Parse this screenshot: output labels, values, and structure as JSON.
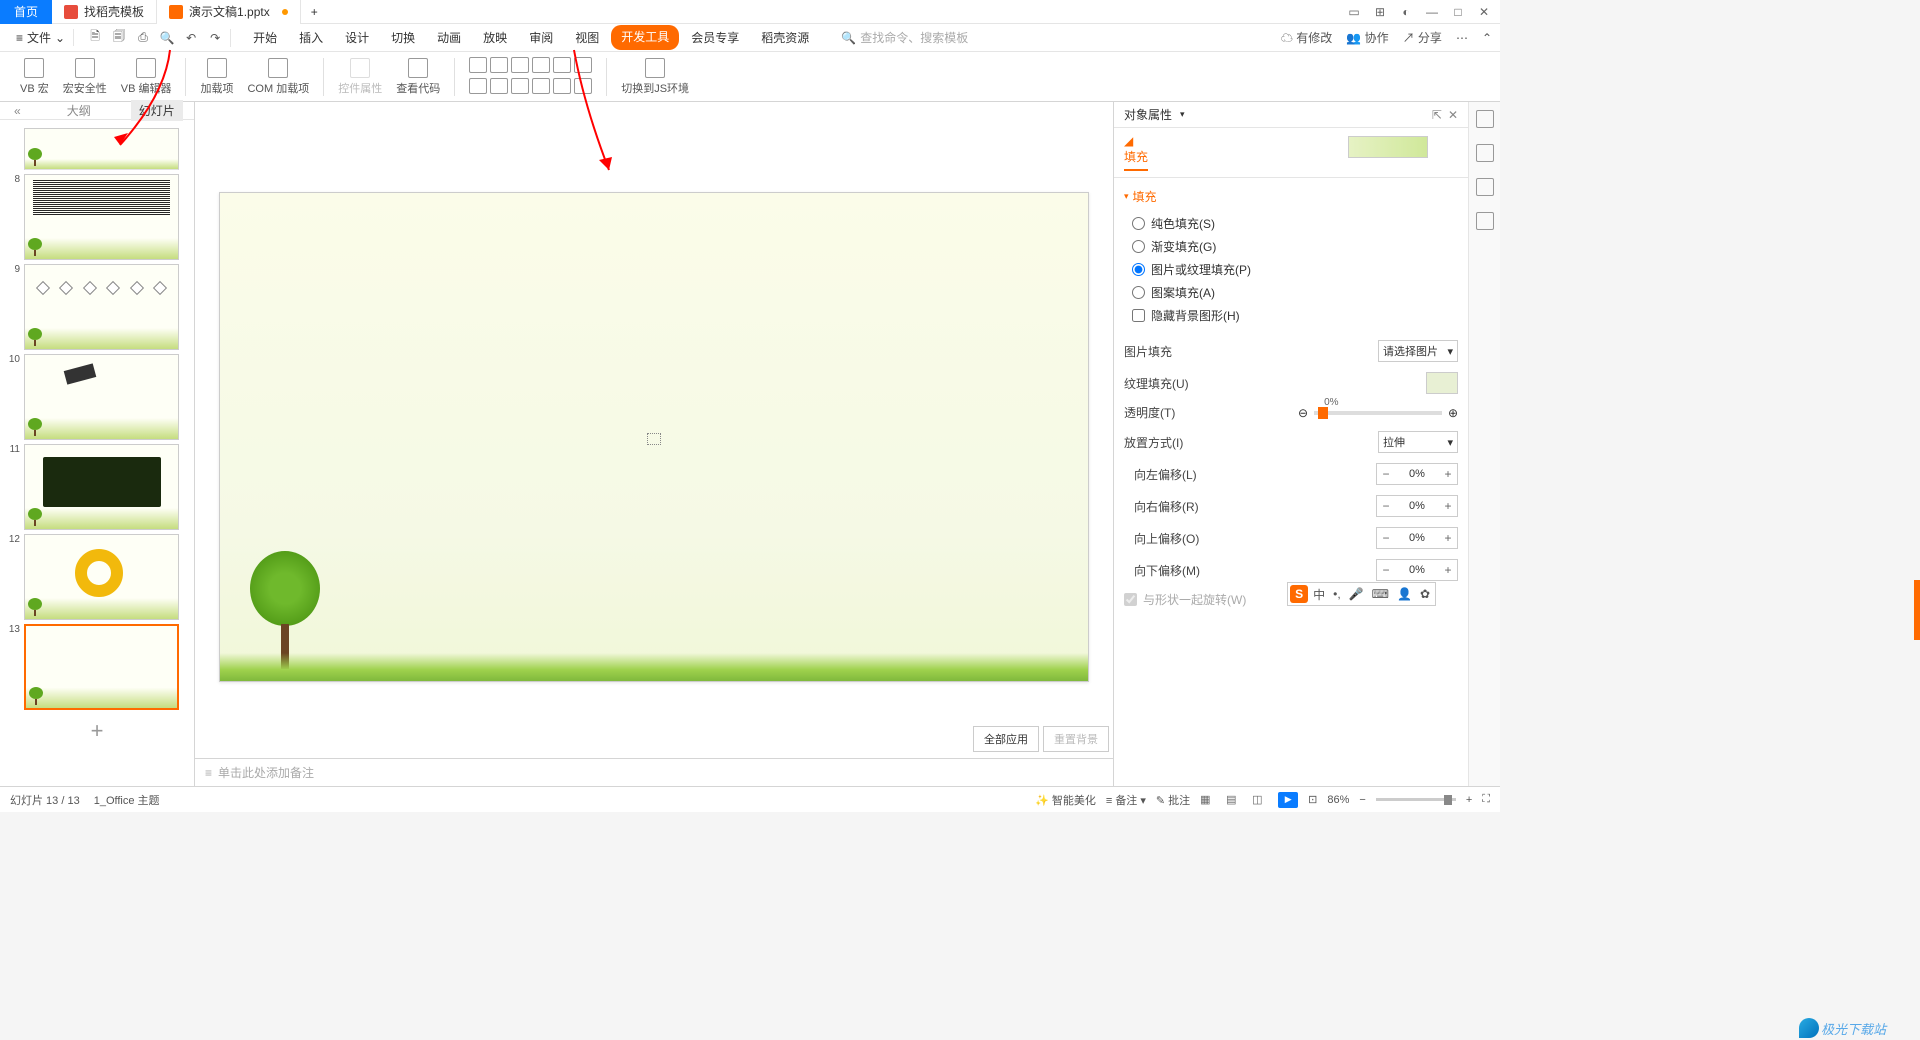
{
  "tabs": {
    "home": "首页",
    "doc1": "找稻壳模板",
    "doc2": "演示文稿1.pptx",
    "add": "+"
  },
  "file_menu": "文件",
  "menu": {
    "start": "开始",
    "insert": "插入",
    "design": "设计",
    "transition": "切换",
    "animation": "动画",
    "slideshow": "放映",
    "review": "审阅",
    "view": "视图",
    "developer": "开发工具",
    "member": "会员专享",
    "resource": "稻壳资源"
  },
  "search_placeholder": "查找命令、搜索模板",
  "top_right": {
    "pending": "有修改",
    "coop": "协作",
    "share": "分享"
  },
  "ribbon": {
    "vb_macro": "VB 宏",
    "macro_security": "宏安全性",
    "vb_editor": "VB 编辑器",
    "addins": "加载项",
    "com_addins": "COM 加载项",
    "ctl_props": "控件属性",
    "view_code": "查看代码",
    "switch_js": "切换到JS环境"
  },
  "outline": {
    "collapse": "«",
    "tab_outline": "大纲",
    "tab_slides": "幻灯片",
    "add": "+"
  },
  "thumbs": [
    {
      "num": "8"
    },
    {
      "num": "9"
    },
    {
      "num": "10"
    },
    {
      "num": "11"
    },
    {
      "num": "12"
    },
    {
      "num": "13"
    }
  ],
  "notes_placeholder": "单击此处添加备注",
  "panel_actions": {
    "apply_all": "全部应用",
    "reset_bg": "重置背景"
  },
  "rp": {
    "title": "对象属性",
    "subtab": "填充",
    "section": "填充",
    "solid": "纯色填充(S)",
    "gradient": "渐变填充(G)",
    "picture": "图片或纹理填充(P)",
    "pattern": "图案填充(A)",
    "hide": "隐藏背景图形(H)",
    "pic_fill": "图片填充",
    "pic_select": "请选择图片",
    "texture": "纹理填充(U)",
    "transparency": "透明度(T)",
    "transparency_val": "0%",
    "tile": "放置方式(I)",
    "tile_val": "拉伸",
    "offset_l": "向左偏移(L)",
    "offset_r": "向右偏移(R)",
    "offset_u": "向上偏移(O)",
    "offset_d": "向下偏移(M)",
    "offset_val": "0%",
    "rotate": "与形状一起旋转(W)"
  },
  "status": {
    "slide_pos": "幻灯片 13 / 13",
    "theme": "1_Office 主题",
    "beautify": "智能美化",
    "notes": "备注",
    "comment": "批注",
    "zoom": "86%"
  },
  "watermark": "极光下载站"
}
